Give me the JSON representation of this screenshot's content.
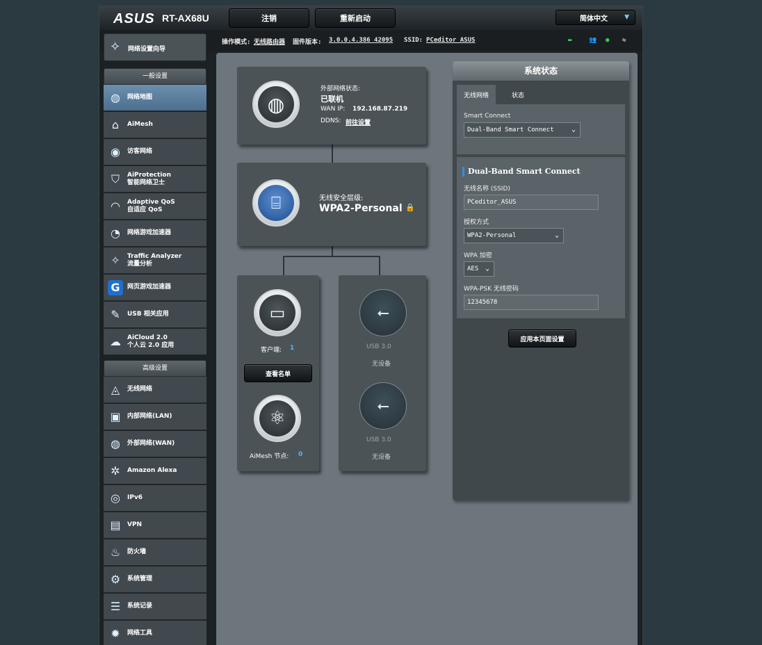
{
  "header": {
    "logo": "ASUS",
    "model": "RT-AX68U",
    "top_buttons": [
      "注销",
      "重新启动"
    ],
    "language": "简体中文"
  },
  "infobar": {
    "mode_label": "操作模式:",
    "mode_value": "无线路由器",
    "firmware_label": "固件版本:",
    "firmware_value": "3.0.0.4.386_42095",
    "ssid_label": "SSID:",
    "ssid_value": "PCeditor_ASUS"
  },
  "sidebar": {
    "quick_setup": "网络设置向导",
    "general_title": "一般设置",
    "general_items": [
      "网络地图",
      "AiMesh",
      "访客网络",
      "AiProtection\n智能网络卫士",
      "Adaptive QoS\n自适应 QoS",
      "网络游戏加速器",
      "Traffic Analyzer\n流量分析",
      "网页游戏加速器",
      "USB 相关应用",
      "AiCloud 2.0\n个人云 2.0 应用"
    ],
    "advanced_title": "高级设置",
    "advanced_items": [
      "无线网络",
      "内部网络(LAN)",
      "外部网络(WAN)",
      "Amazon Alexa",
      "IPv6",
      "VPN",
      "防火墙",
      "系统管理",
      "系统记录",
      "网络工具"
    ]
  },
  "internet": {
    "status_label": "外部网络状态:",
    "status_value": "已联机",
    "wan_ip_label": "WAN IP:",
    "wan_ip": "192.168.87.219",
    "ddns_label": "DDNS:",
    "ddns_value": "前往设置"
  },
  "security": {
    "label": "无线安全层级:",
    "value": "WPA2-Personal"
  },
  "clients": {
    "label": "客户端:",
    "count": "1",
    "button": "查看名单"
  },
  "aimesh": {
    "label": "AiMesh 节点:",
    "count": "0"
  },
  "usb": [
    {
      "name": "USB 3.0",
      "status": "无设备"
    },
    {
      "name": "USB 3.0",
      "status": "无设备"
    }
  ],
  "system_panel": {
    "title": "系统状态",
    "tabs": [
      "无线网络",
      "状态"
    ],
    "smart_connect_label": "Smart Connect",
    "smart_connect_value": "Dual-Band Smart Connect",
    "band_title": "Dual-Band Smart Connect",
    "ssid_label": "无线名称 (SSID)",
    "ssid_value": "PCeditor_ASUS",
    "auth_label": "授权方式",
    "auth_value": "WPA2-Personal",
    "wpa_enc_label": "WPA 加密",
    "wpa_enc_value": "AES",
    "psk_label": "WPA-PSK 无线密码",
    "psk_value": "12345678",
    "apply_button": "应用本页面设置"
  },
  "colors": {
    "accent": "#5ab4ff",
    "active_nav": "#5a7d9e",
    "status_green": "#35d04a"
  }
}
